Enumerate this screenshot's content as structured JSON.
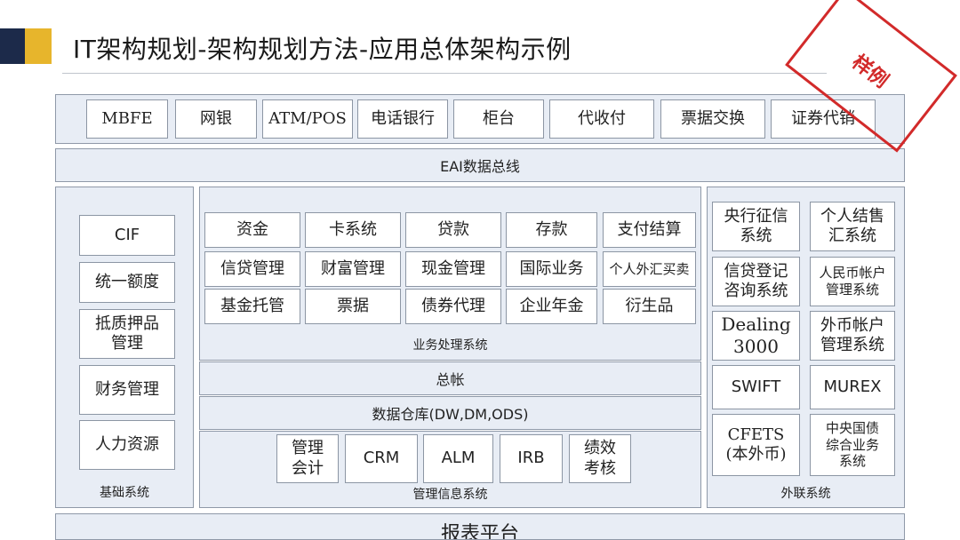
{
  "header": {
    "title": "IT架构规划-架构规划方法-应用总体架构示例"
  },
  "stamp": {
    "text": "样例",
    "color": "#d22a2a"
  },
  "channels": [
    "MBFE",
    "网银",
    "ATM/POS",
    "电话银行",
    "柜台",
    "代收付",
    "票据交换",
    "证券代销"
  ],
  "eai_bus": "EAI数据总线",
  "basic": {
    "items": [
      "CIF",
      "统一额度",
      "抵质押品\n管理",
      "财务管理",
      "人力资源"
    ],
    "caption": "基础系统"
  },
  "business": {
    "rows": [
      [
        "资金",
        "卡系统",
        "贷款",
        "存款",
        "支付结算"
      ],
      [
        "信贷管理",
        "财富管理",
        "现金管理",
        "国际业务",
        "个人外汇买卖"
      ],
      [
        "基金托管",
        "票据",
        "债券代理",
        "企业年金",
        "衍生品"
      ]
    ],
    "caption": "业务处理系统"
  },
  "ledger": "总帐",
  "warehouse": "数据仓库(DW,DM,ODS)",
  "mis": {
    "items": [
      "管理\n会计",
      "CRM",
      "ALM",
      "IRB",
      "绩效\n考核"
    ],
    "caption": "管理信息系统"
  },
  "external": {
    "items": [
      "央行征信\n系统",
      "个人结售\n汇系统",
      "信贷登记\n咨询系统",
      "人民币帐户\n管理系统",
      "Dealing\n3000",
      "外币帐户\n管理系统",
      "SWIFT",
      "MUREX",
      "CFETS\n(本外币)",
      "中央国债\n综合业务\n系统"
    ],
    "caption": "外联系统"
  },
  "report": "报表平台"
}
